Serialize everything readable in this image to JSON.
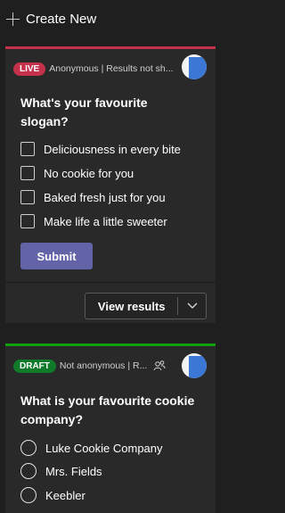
{
  "header": {
    "title": "Create New"
  },
  "card1": {
    "status": "LIVE",
    "meta": "Anonymous | Results not sh...",
    "question": "What's your favourite slogan?",
    "options": [
      "Deliciousness in every bite",
      "No cookie for you",
      "Baked fresh just for you",
      "Make life a little sweeter"
    ],
    "submit_label": "Submit",
    "view_results_label": "View results"
  },
  "card2": {
    "status": "DRAFT",
    "meta": "Not anonymous | R...",
    "question": "What is your favourite cookie company?",
    "options": [
      "Luke Cookie Company",
      "Mrs. Fields",
      "Keebler"
    ]
  },
  "colors": {
    "live": "#c4314b",
    "draft": "#13a10e",
    "accent": "#6264a7"
  }
}
